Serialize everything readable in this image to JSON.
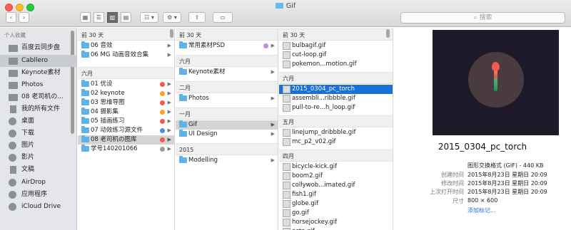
{
  "window": {
    "title": "Gif"
  },
  "toolbar": {
    "back": "‹",
    "forward": "›",
    "arrange": "☷ ▾",
    "action": "⚙ ▾",
    "share": "⇪",
    "tag": "▭",
    "search_placeholder": "搜索",
    "view_icon": "▦",
    "view_list": "☰",
    "view_columns": "▥",
    "view_cover": "▤"
  },
  "sidebar": {
    "header": "个人收藏",
    "items": [
      {
        "label": "百度云同步盘",
        "icon": "folder-icon"
      },
      {
        "label": "Cabllero",
        "icon": "folder-icon",
        "selected": true
      },
      {
        "label": "Keynote素材",
        "icon": "folder-icon"
      },
      {
        "label": "Photos",
        "icon": "folder-icon"
      },
      {
        "label": "08 老司机の...",
        "icon": "folder-icon"
      },
      {
        "label": "我的所有文件",
        "icon": "all-files-icon"
      },
      {
        "label": "桌面",
        "icon": "desktop-icon"
      },
      {
        "label": "下载",
        "icon": "download-icon"
      },
      {
        "label": "图片",
        "icon": "pictures-icon"
      },
      {
        "label": "影片",
        "icon": "movies-icon"
      },
      {
        "label": "文稿",
        "icon": "documents-icon"
      },
      {
        "label": "AirDrop",
        "icon": "airdrop-icon"
      },
      {
        "label": "应用程序",
        "icon": "applications-icon"
      },
      {
        "label": "iCloud Drive",
        "icon": "icloud-icon"
      }
    ]
  },
  "col1": {
    "sections": [
      {
        "header": "前 30 天",
        "rows": [
          {
            "label": "06 音效"
          },
          {
            "label": "06 MG 动画音效合集"
          }
        ]
      },
      {
        "header": "六月",
        "rows": [
          {
            "label": "01 优设",
            "tag": "#f05b4f"
          },
          {
            "label": "02 keynote",
            "tag": "#f5a623"
          },
          {
            "label": "03 思维导图",
            "tag": "#f05b4f"
          },
          {
            "label": "04 摄影集",
            "tag": "#f5a623"
          },
          {
            "label": "05 插画练习",
            "tag": "#f05b4f"
          },
          {
            "label": "07 动效练习源文件",
            "tag": "#4a90e2"
          },
          {
            "label": "08 老司机の图库",
            "tag": "#f05b4f",
            "selected": true
          },
          {
            "label": "学号140201066",
            "tag": "#9b9b9b"
          }
        ]
      }
    ]
  },
  "col2": {
    "sections": [
      {
        "header": "前 30 天",
        "rows": [
          {
            "label": "常用素材PSD",
            "tag": "#c38be0"
          }
        ]
      },
      {
        "header": "六月",
        "rows": [
          {
            "label": "Keynote素材"
          }
        ]
      },
      {
        "header": "二月",
        "rows": [
          {
            "label": "Photos"
          }
        ]
      },
      {
        "header": "一月",
        "rows": [
          {
            "label": "Gif",
            "selected": true
          },
          {
            "label": "UI Design"
          }
        ]
      },
      {
        "header": "2015",
        "rows": [
          {
            "label": "Modelling"
          }
        ]
      }
    ]
  },
  "col3": {
    "sections": [
      {
        "header": "前 30 天",
        "rows": [
          {
            "label": "bulbagif.gif"
          },
          {
            "label": "cut-loop.gif"
          },
          {
            "label": "pokemon...motion.gif"
          }
        ]
      },
      {
        "header": "六月",
        "rows": [
          {
            "label": "2015_0304_pc_torch",
            "selected": true
          },
          {
            "label": "assembli...ribbble.gif"
          },
          {
            "label": "pull-to-re...h_loop.gif"
          }
        ]
      },
      {
        "header": "五月",
        "rows": [
          {
            "label": "linejump_dribbble.gif"
          },
          {
            "label": "mc_p2_v02.gif"
          }
        ]
      },
      {
        "header": "四月",
        "rows": [
          {
            "label": "bicycle-kick.gif"
          },
          {
            "label": "boom2.gif"
          },
          {
            "label": "collywob...imated.gif"
          },
          {
            "label": "fish1.gif"
          },
          {
            "label": "globe.gif"
          },
          {
            "label": "go.gif"
          },
          {
            "label": "horsejockey.gif"
          },
          {
            "label": "octo.gif"
          }
        ]
      }
    ]
  },
  "preview": {
    "name": "2015_0304_pc_torch",
    "meta": [
      {
        "label": "",
        "value": "图形交换格式 (GIF) - 440 KB"
      },
      {
        "label": "创建时间",
        "value": "2015年8月23日 星期日 20:09"
      },
      {
        "label": "修改时间",
        "value": "2015年8月23日 星期日 20:09"
      },
      {
        "label": "上次打开时间",
        "value": "2015年8月23日 星期日 20:09"
      },
      {
        "label": "尺寸",
        "value": "800 × 600"
      },
      {
        "label": "",
        "value": "添加标记..."
      }
    ]
  },
  "colors": {
    "sidebar_bg": "#e4e6e9",
    "selection": "#1b6fd8",
    "folder": "#5db2e8"
  }
}
